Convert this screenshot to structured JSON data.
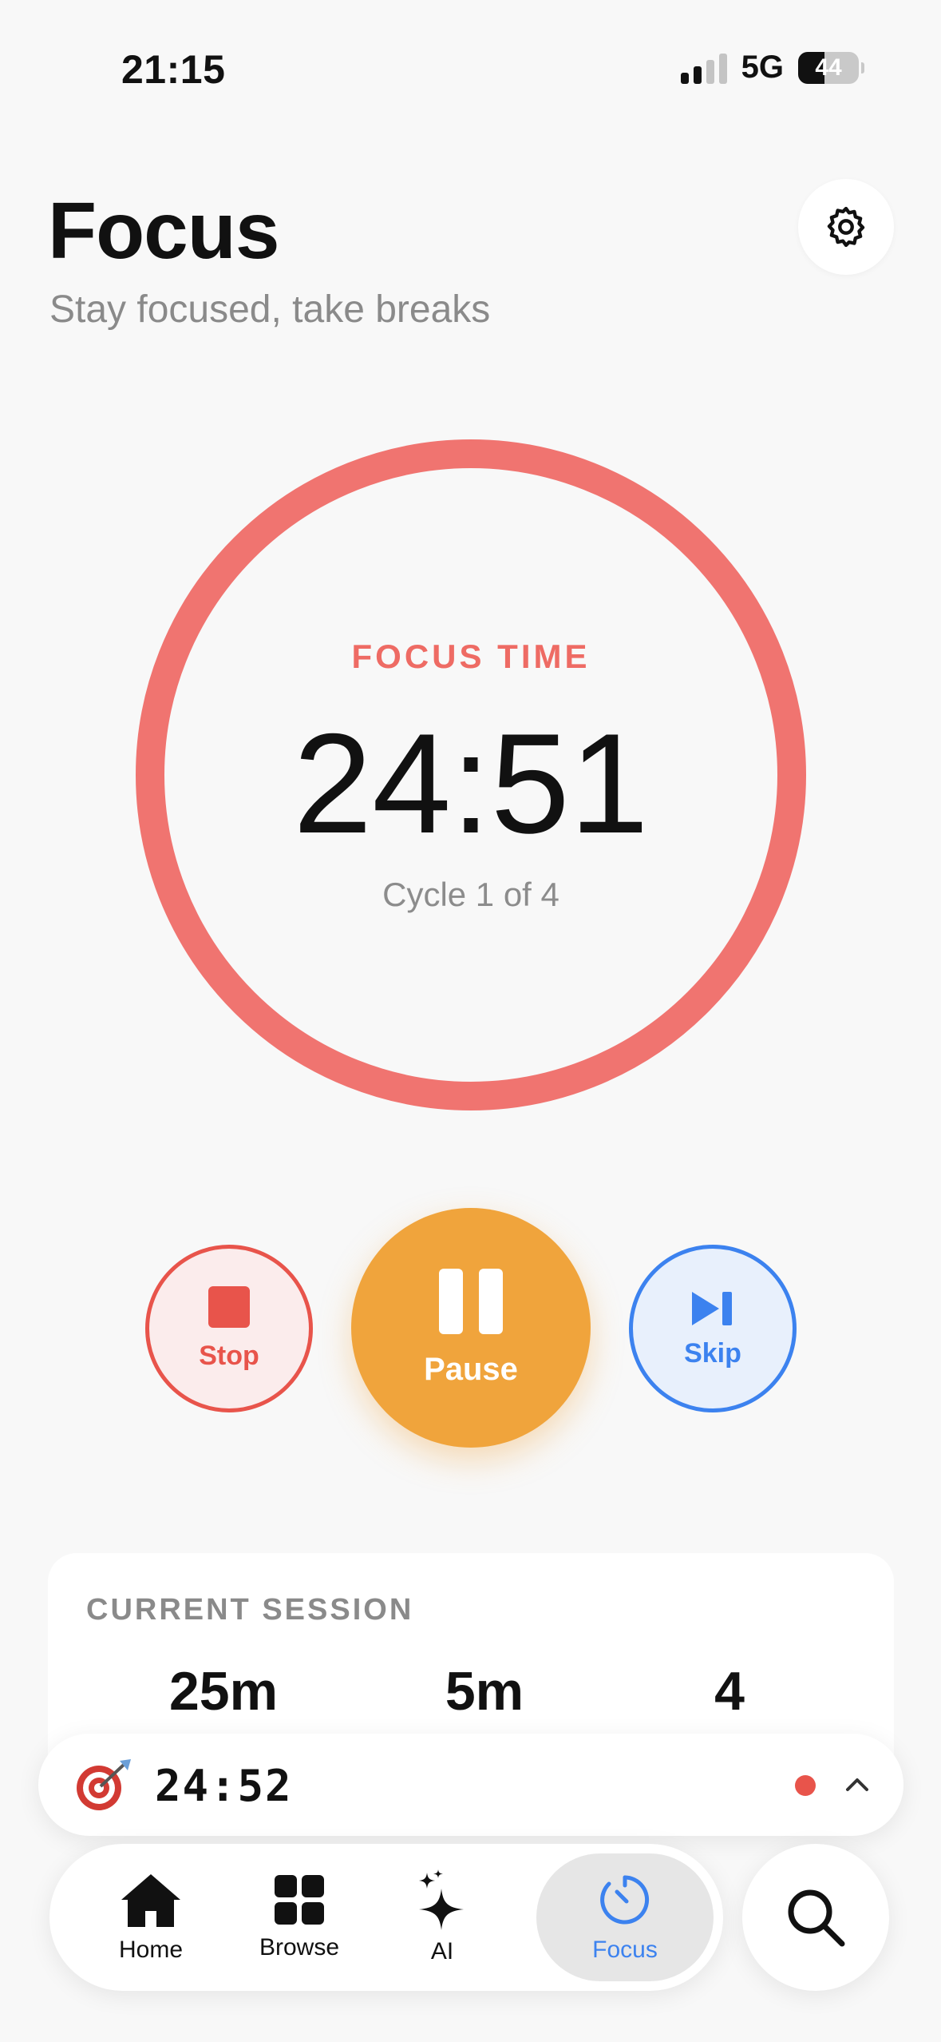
{
  "status_bar": {
    "time": "21:15",
    "network": "5G",
    "battery": "44",
    "battery_level": 0.44,
    "signal_bars_active": 2,
    "signal_bars_total": 4
  },
  "header": {
    "title": "Focus",
    "subtitle": "Stay focused, take breaks",
    "settings_icon": "gear-icon"
  },
  "timer": {
    "mode_label": "FOCUS TIME",
    "time": "24:51",
    "cycle": "Cycle 1 of 4",
    "progress": 0.0,
    "ring_color": "#f07470"
  },
  "controls": {
    "stop": {
      "label": "Stop",
      "icon": "stop-square-icon",
      "color": "#e8544b"
    },
    "pause": {
      "label": "Pause",
      "icon": "pause-icon",
      "color": "#f0a43c"
    },
    "skip": {
      "label": "Skip",
      "icon": "skip-forward-icon",
      "color": "#3c82ef"
    }
  },
  "session": {
    "title": "CURRENT SESSION",
    "values": [
      "25m",
      "5m",
      "4"
    ]
  },
  "mini_player": {
    "icon": "target-icon",
    "time": "24:52",
    "recording_dot_color": "#e8544b",
    "chevron": "chevron-up-icon"
  },
  "tabbar": {
    "tabs": [
      {
        "label": "Home",
        "icon": "house-icon"
      },
      {
        "label": "Browse",
        "icon": "grid-icon"
      },
      {
        "label": "AI",
        "icon": "sparkles-icon"
      },
      {
        "label": "Focus",
        "icon": "timer-icon",
        "active": true
      }
    ],
    "search_icon": "search-icon"
  },
  "colors": {
    "accent": "#3c82ef",
    "focus_red": "#ee6b64",
    "background": "#f8f8f8"
  }
}
